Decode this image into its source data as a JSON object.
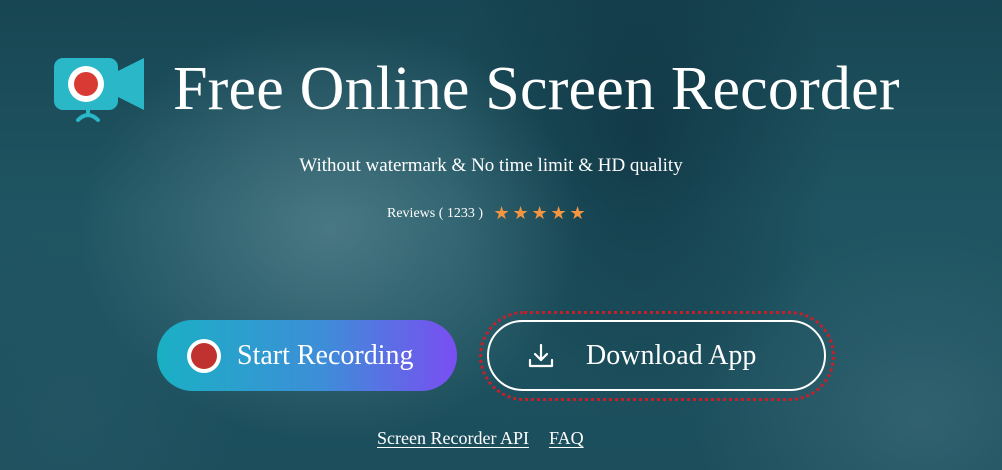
{
  "header": {
    "title": "Free Online Screen Recorder",
    "logo_icon": "screen-recorder-logo-icon"
  },
  "tagline": "Without watermark & No time limit & HD quality",
  "reviews": {
    "label": "Reviews ( 1233 )",
    "rating": 5,
    "max_rating": 5,
    "star_icon": "star-icon",
    "star_color": "#f4953f"
  },
  "actions": {
    "start_recording": {
      "label": "Start Recording",
      "icon": "record-icon",
      "gradient": [
        "#1ab0c4",
        "#3d8ed8",
        "#7a4ef2"
      ]
    },
    "download_app": {
      "label": "Download App",
      "icon": "download-icon",
      "focus_ring_color": "#c61f2a"
    }
  },
  "footer_links": [
    "Screen Recorder API",
    "FAQ"
  ],
  "colors": {
    "background": "#1f5562",
    "text": "#ffffff",
    "logo_camera": "#2ab8c8",
    "record_red": "#c0322f"
  }
}
